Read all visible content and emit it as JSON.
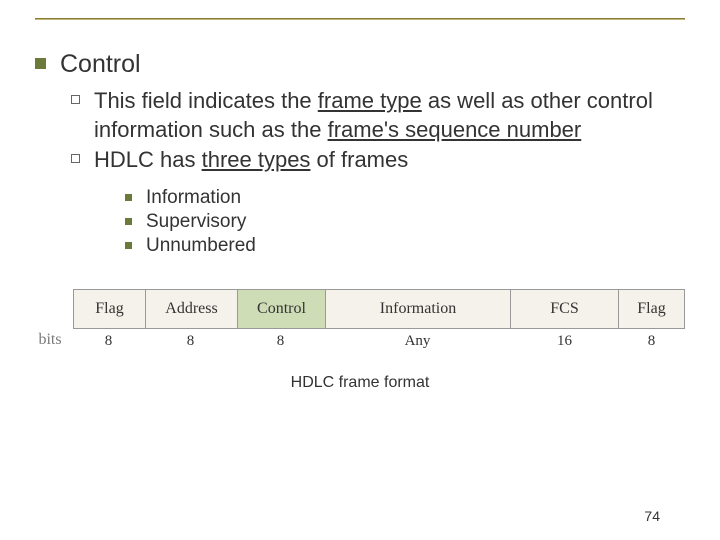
{
  "heading": "Control",
  "point1_a": "This field indicates the ",
  "point1_u1": "frame type",
  "point1_b": " as well as other control information such as the ",
  "point1_u2": "frame's sequence number",
  "point2_a": "HDLC has ",
  "point2_u": "three types",
  "point2_b": " of frames",
  "sub1": "Information",
  "sub2": "Supervisory",
  "sub3": "Unnumbered",
  "bits_label": "bits",
  "frame": {
    "flag1": "Flag",
    "address": "Address",
    "control": "Control",
    "info": "Information",
    "fcs": "FCS",
    "flag2": "Flag"
  },
  "bits": {
    "flag1": "8",
    "address": "8",
    "control": "8",
    "info": "Any",
    "fcs": "16",
    "flag2": "8"
  },
  "caption": "HDLC frame format",
  "page": "74"
}
